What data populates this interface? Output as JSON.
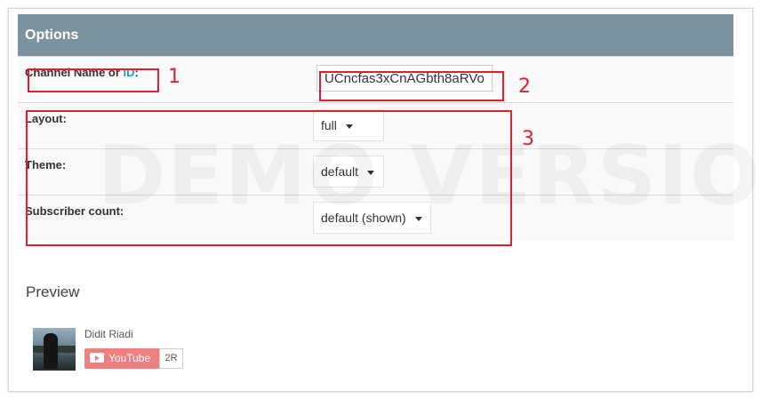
{
  "options": {
    "header": "Options",
    "watermark": "DEMO VERSION",
    "channel": {
      "label_prefix": "Channel Name or ",
      "label_link": "ID",
      "label_suffix": ":",
      "value": "UCncfas3xCnAGbth8aRVo"
    },
    "layout": {
      "label": "Layout:",
      "value": "full"
    },
    "theme": {
      "label": "Theme:",
      "value": "default"
    },
    "subscriber_count": {
      "label": "Subscriber count:",
      "value": "default (shown)"
    }
  },
  "annotations": {
    "one": "1",
    "two": "2",
    "three": "3",
    "color": "#e0202e"
  },
  "preview": {
    "title": "Preview",
    "channel_name": "Didit Riadi",
    "button_label": "YouTube",
    "subscriber_count": "2R"
  },
  "colors": {
    "header": "#7b939f",
    "link": "#1e9bd7",
    "youtube_button": "#f08080"
  }
}
